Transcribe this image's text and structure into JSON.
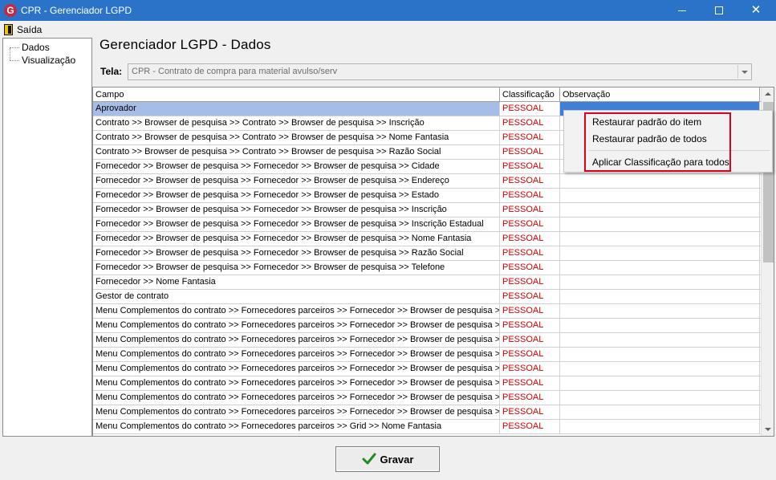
{
  "window": {
    "title": "CPR - Gerenciador LGPD",
    "app_icon_letter": "G"
  },
  "menu": {
    "exit_label": "Saída"
  },
  "tree": {
    "items": [
      {
        "label": "Dados"
      },
      {
        "label": "Visualização"
      }
    ]
  },
  "page": {
    "title": "Gerenciador LGPD - Dados"
  },
  "tela": {
    "label": "Tela:",
    "value": "CPR - Contrato de compra para material avulso/serv"
  },
  "grid": {
    "columns": [
      "Campo",
      "Classificação",
      "Observação"
    ],
    "rows": [
      {
        "campo": "Aprovador",
        "classificacao": "PESSOAL",
        "observacao": ""
      },
      {
        "campo": "Contrato >> Browser de pesquisa >> Contrato >> Browser de pesquisa >> Inscrição",
        "classificacao": "PESSOAL",
        "observacao": ""
      },
      {
        "campo": "Contrato >> Browser de pesquisa >> Contrato >> Browser de pesquisa >> Nome Fantasia",
        "classificacao": "PESSOAL",
        "observacao": ""
      },
      {
        "campo": "Contrato >> Browser de pesquisa >> Contrato >> Browser de pesquisa >> Razão Social",
        "classificacao": "PESSOAL",
        "observacao": ""
      },
      {
        "campo": "Fornecedor >> Browser de pesquisa >> Fornecedor >> Browser de pesquisa >> Cidade",
        "classificacao": "PESSOAL",
        "observacao": ""
      },
      {
        "campo": "Fornecedor >> Browser de pesquisa >> Fornecedor >> Browser de pesquisa >> Endereço",
        "classificacao": "PESSOAL",
        "observacao": ""
      },
      {
        "campo": "Fornecedor >> Browser de pesquisa >> Fornecedor >> Browser de pesquisa >> Estado",
        "classificacao": "PESSOAL",
        "observacao": ""
      },
      {
        "campo": "Fornecedor >> Browser de pesquisa >> Fornecedor >> Browser de pesquisa >> Inscrição",
        "classificacao": "PESSOAL",
        "observacao": ""
      },
      {
        "campo": "Fornecedor >> Browser de pesquisa >> Fornecedor >> Browser de pesquisa >> Inscrição Estadual",
        "classificacao": "PESSOAL",
        "observacao": ""
      },
      {
        "campo": "Fornecedor >> Browser de pesquisa >> Fornecedor >> Browser de pesquisa >> Nome Fantasia",
        "classificacao": "PESSOAL",
        "observacao": ""
      },
      {
        "campo": "Fornecedor >> Browser de pesquisa >> Fornecedor >> Browser de pesquisa >> Razão Social",
        "classificacao": "PESSOAL",
        "observacao": ""
      },
      {
        "campo": "Fornecedor >> Browser de pesquisa >> Fornecedor >> Browser de pesquisa >> Telefone",
        "classificacao": "PESSOAL",
        "observacao": ""
      },
      {
        "campo": "Fornecedor >> Nome Fantasia",
        "classificacao": "PESSOAL",
        "observacao": ""
      },
      {
        "campo": "Gestor de contrato",
        "classificacao": "PESSOAL",
        "observacao": ""
      },
      {
        "campo": "Menu Complementos do contrato >> Fornecedores parceiros >> Fornecedor >> Browser de pesquisa >> ...",
        "classificacao": "PESSOAL",
        "observacao": ""
      },
      {
        "campo": "Menu Complementos do contrato >> Fornecedores parceiros >> Fornecedor >> Browser de pesquisa >> ...",
        "classificacao": "PESSOAL",
        "observacao": ""
      },
      {
        "campo": "Menu Complementos do contrato >> Fornecedores parceiros >> Fornecedor >> Browser de pesquisa >> ...",
        "classificacao": "PESSOAL",
        "observacao": ""
      },
      {
        "campo": "Menu Complementos do contrato >> Fornecedores parceiros >> Fornecedor >> Browser de pesquisa >> ...",
        "classificacao": "PESSOAL",
        "observacao": ""
      },
      {
        "campo": "Menu Complementos do contrato >> Fornecedores parceiros >> Fornecedor >> Browser de pesquisa >> ...",
        "classificacao": "PESSOAL",
        "observacao": ""
      },
      {
        "campo": "Menu Complementos do contrato >> Fornecedores parceiros >> Fornecedor >> Browser de pesquisa >> ...",
        "classificacao": "PESSOAL",
        "observacao": ""
      },
      {
        "campo": "Menu Complementos do contrato >> Fornecedores parceiros >> Fornecedor >> Browser de pesquisa >> ...",
        "classificacao": "PESSOAL",
        "observacao": ""
      },
      {
        "campo": "Menu Complementos do contrato >> Fornecedores parceiros >> Fornecedor >> Browser de pesquisa >> ...",
        "classificacao": "PESSOAL",
        "observacao": ""
      },
      {
        "campo": "Menu Complementos do contrato >> Fornecedores parceiros >> Grid >> Nome Fantasia",
        "classificacao": "PESSOAL",
        "observacao": ""
      }
    ]
  },
  "context_menu": {
    "items": [
      {
        "label": "Restaurar padrão do item"
      },
      {
        "label": "Restaurar padrão de todos"
      },
      {
        "label": "Aplicar Classificação para todos"
      }
    ]
  },
  "footer": {
    "save_label": "Gravar"
  },
  "colors": {
    "titlebar": "#2b73c9",
    "classification_text": "#d40000",
    "selection": "#a6bde8",
    "highlight_outline": "#e0001a",
    "check": "#1e8f1e"
  },
  "icons": {
    "exit": "exit-door-icon",
    "save": "checkmark-icon",
    "app": "app-logo-icon"
  }
}
